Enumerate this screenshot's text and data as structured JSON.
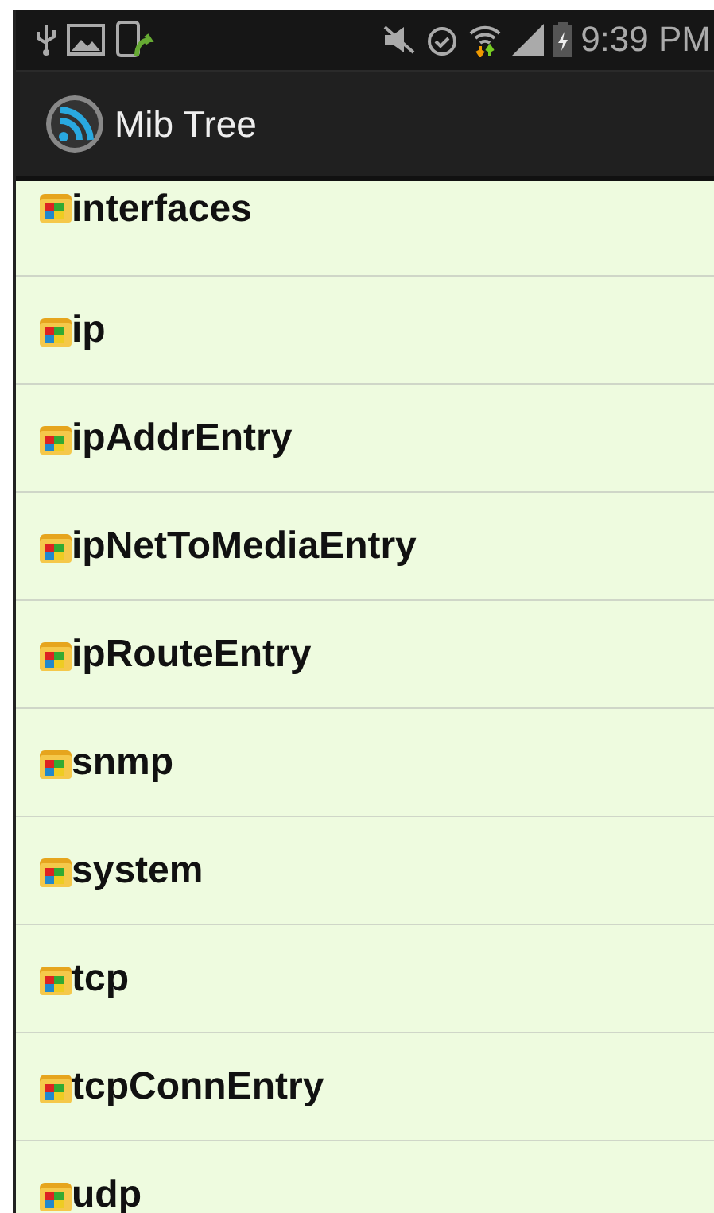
{
  "status_bar": {
    "time": "9:39 PM"
  },
  "action_bar": {
    "title": "Mib Tree"
  },
  "items": [
    {
      "label": "interfaces"
    },
    {
      "label": "ip"
    },
    {
      "label": "ipAddrEntry"
    },
    {
      "label": "ipNetToMediaEntry"
    },
    {
      "label": "ipRouteEntry"
    },
    {
      "label": "snmp"
    },
    {
      "label": "system"
    },
    {
      "label": "tcp"
    },
    {
      "label": "tcpConnEntry"
    },
    {
      "label": "udp"
    }
  ]
}
